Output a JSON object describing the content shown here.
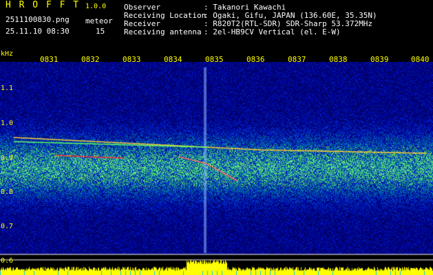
{
  "header": {
    "app_title": "H R O F F T",
    "version": "1.0.0",
    "filename": "2511100830.png",
    "meteor_label": "meteor",
    "datetime": "25.11.10 08:30",
    "meteor_count": "15",
    "info": [
      {
        "key": "Observer",
        "value": ": Takanori Kawachi"
      },
      {
        "key": "Receiving Location",
        "value": ": Ogaki, Gifu, JAPAN (136.60E, 35.35N)"
      },
      {
        "key": "Receiver",
        "value": ": R820T2(RTL-SDR) SDR-Sharp 53.372MHz"
      },
      {
        "key": "Receiving antenna",
        "value": ": 2el-HB9CV Vertical (el. E-W)"
      }
    ]
  },
  "spectrogram": {
    "unit_label": "kHz",
    "time_ticks": [
      "0831",
      "0832",
      "0833",
      "0834",
      "0835",
      "0836",
      "0837",
      "0838",
      "0839",
      "0840"
    ],
    "freq_ticks": [
      "1.1",
      "1.0",
      "0.9",
      "0.8",
      "0.7",
      "0.6"
    ]
  },
  "colors": {
    "text_yellow": "#ffff00",
    "text_white": "#ffffff",
    "background_dark": "#000000",
    "noise_blue": "#1a3a9a"
  }
}
